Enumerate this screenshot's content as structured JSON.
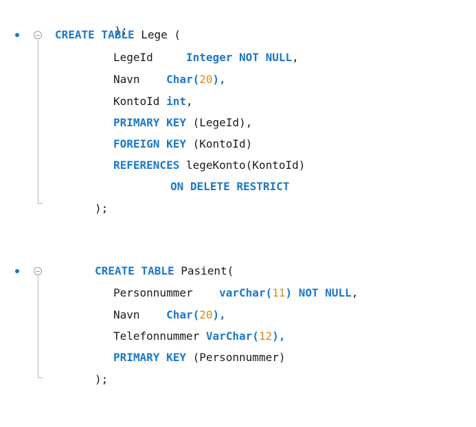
{
  "block0": {
    "close": ");"
  },
  "block1": {
    "create": "CREATE TABLE",
    "name": "Lege (",
    "col1_name": "LegeId",
    "col1_type": "Integer NOT NULL",
    "col1_end": ",",
    "col2_name": "Navn",
    "col2_type": "Char(",
    "col2_len": "20",
    "col2_end": "),",
    "col3_name": "KontoId",
    "col3_type": "int",
    "col3_end": ",",
    "pk_kw": "PRIMARY KEY",
    "pk_cols": "(LegeId),",
    "fk_kw": "FOREIGN KEY",
    "fk_cols": "(KontoId)",
    "ref_kw": "REFERENCES",
    "ref_target": "legeKonto(KontoId)",
    "on_delete": "ON DELETE RESTRICT",
    "close": ");"
  },
  "block2": {
    "create": "CREATE TABLE",
    "name": "Pasient(",
    "col1_name": "Personnummer",
    "col1_type": "varChar(",
    "col1_len": "11",
    "col1_mid": ")",
    "col1_kw": "NOT NULL",
    "col1_end": ",",
    "col2_name": "Navn",
    "col2_type": "Char(",
    "col2_len": "20",
    "col2_end": "),",
    "col3_name": "Telefonnummer",
    "col3_type": "VarChar(",
    "col3_len": "12",
    "col3_end": "),",
    "pk_kw": "PRIMARY KEY",
    "pk_cols": "(Personnummer)",
    "close": ");"
  },
  "colors": {
    "keyword": "#1b78c8",
    "number": "#d98a1a",
    "text": "#1a1a1a"
  },
  "icons": [
    "bullet-marker-icon",
    "fold-collapse-icon"
  ]
}
